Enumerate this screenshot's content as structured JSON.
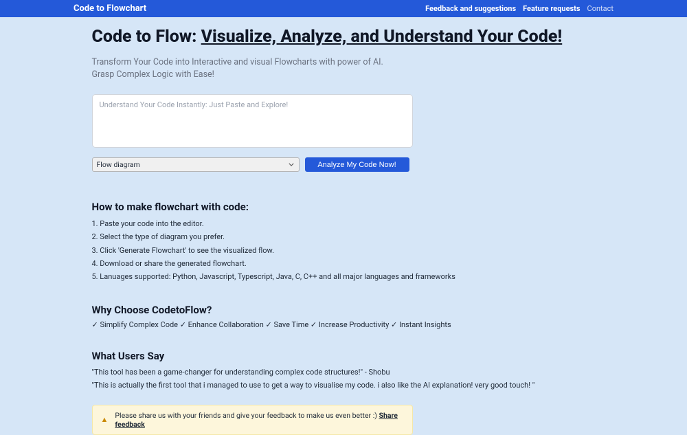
{
  "header": {
    "brand": "Code to Flowchart",
    "nav": [
      {
        "label": "Feedback and suggestions"
      },
      {
        "label": "Feature requests"
      },
      {
        "label": "Contact"
      }
    ]
  },
  "hero": {
    "title_prefix": "Code to Flow: ",
    "title_underlined": "Visualize, Analyze, and Understand Your Code!",
    "subtitle": "Transform Your Code into Interactive and visual Flowcharts with power of AI. Grasp Complex Logic with Ease!",
    "placeholder": "Understand Your Code Instantly: Just Paste and Explore!",
    "select_value": "Flow diagram",
    "button_label": "Analyze My Code Now!"
  },
  "how": {
    "title": "How to make flowchart with code:",
    "steps": [
      "1. Paste your code into the editor.",
      "2. Select the type of diagram you prefer.",
      "3. Click 'Generate Flowchart' to see the visualized flow.",
      "4. Download or share the generated flowchart.",
      "5. Lanuages supported: Python, Javascript, Typescript, Java, C, C++ and all major languages and frameworks"
    ]
  },
  "why": {
    "title": "Why Choose CodetoFlow?",
    "text": "✓ Simplify Complex Code ✓ Enhance Collaboration ✓ Save Time ✓ Increase Productivity ✓ Instant Insights"
  },
  "users": {
    "title": "What Users Say",
    "items": [
      "\"This tool has been a game-changer for understanding complex code structures!\" - Shobu",
      "\"This is actually the first tool that i managed to use to get a way to visualise my code. i also like the AI explanation! very good touch! \""
    ]
  },
  "notice": {
    "text_prefix": "Please share us with your friends and give your feedback to make us even better :) ",
    "link": "Share feedback"
  }
}
